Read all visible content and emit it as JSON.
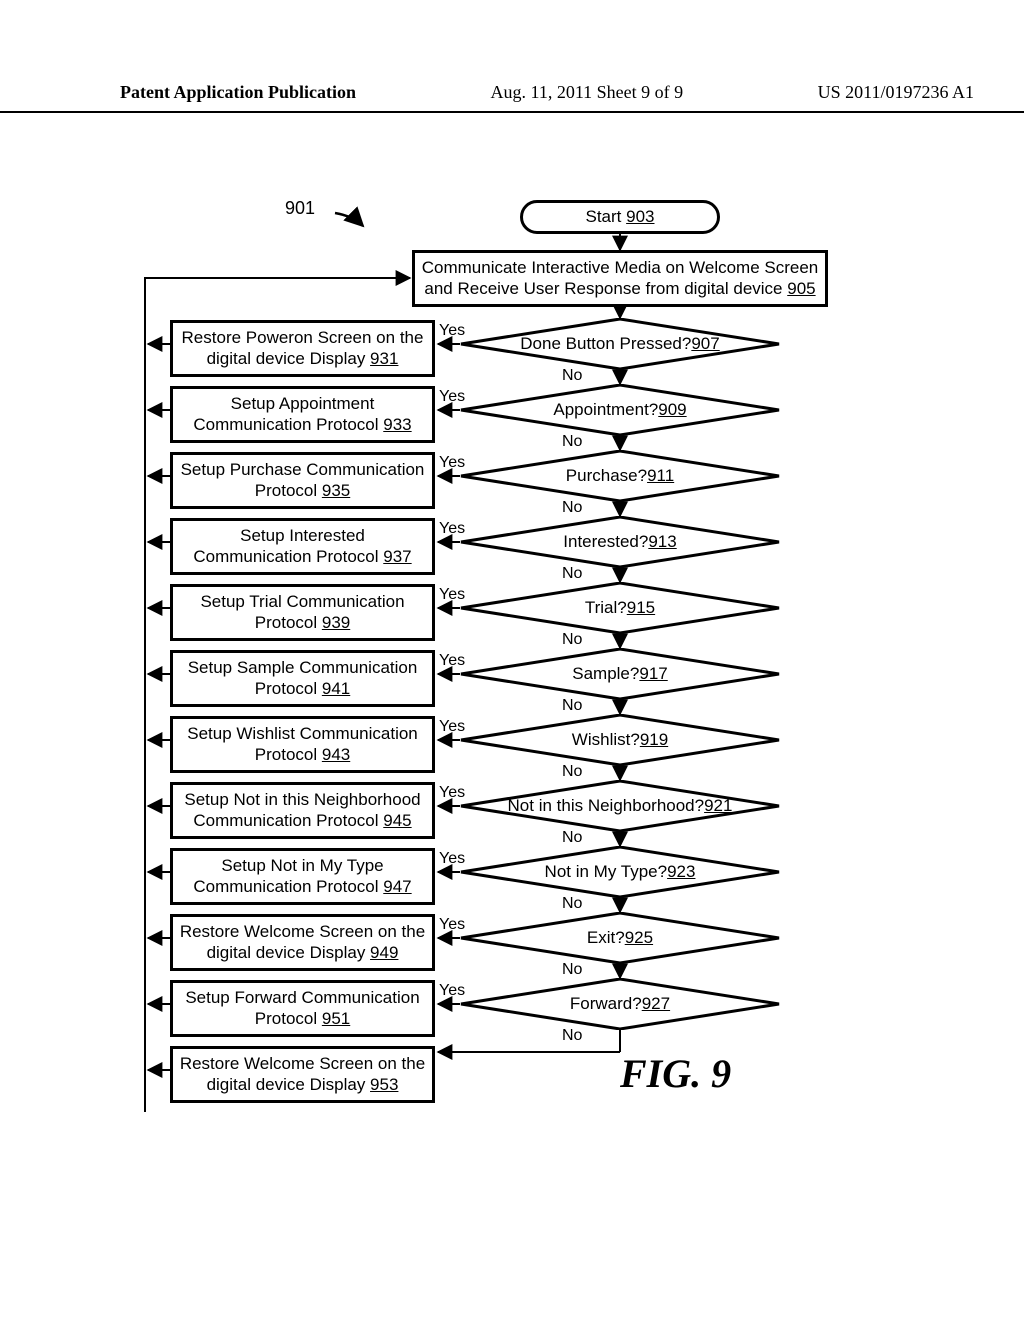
{
  "header": {
    "left": "Patent Application Publication",
    "center": "Aug. 11, 2011  Sheet 9 of 9",
    "right": "US 2011/0197236 A1"
  },
  "ref901": "901",
  "start": {
    "label": "Start ",
    "ref": "903"
  },
  "comm": {
    "label": "Communicate Interactive Media on Welcome Screen and Receive User Response from digital device ",
    "ref": "905"
  },
  "yes": "Yes",
  "no": "No",
  "decisions": [
    {
      "label": "Done Button Pressed? ",
      "ref": "907"
    },
    {
      "label": "Appointment? ",
      "ref": "909"
    },
    {
      "label": "Purchase? ",
      "ref": "911"
    },
    {
      "label": "Interested? ",
      "ref": "913"
    },
    {
      "label": "Trial? ",
      "ref": "915"
    },
    {
      "label": "Sample? ",
      "ref": "917"
    },
    {
      "label": "Wishlist? ",
      "ref": "919"
    },
    {
      "label": "Not in this Neighborhood? ",
      "ref": "921"
    },
    {
      "label": "Not in My Type? ",
      "ref": "923"
    },
    {
      "label": "Exit? ",
      "ref": "925"
    },
    {
      "label": "Forward? ",
      "ref": "927"
    }
  ],
  "actions": [
    {
      "label": "Restore Poweron Screen on the digital device Display ",
      "ref": "931"
    },
    {
      "label": "Setup Appointment Communication Protocol ",
      "ref": "933"
    },
    {
      "label": "Setup Purchase Communication Protocol ",
      "ref": "935"
    },
    {
      "label": "Setup Interested Communication Protocol ",
      "ref": "937"
    },
    {
      "label": "Setup Trial Communication Protocol ",
      "ref": "939"
    },
    {
      "label": "Setup Sample Communication Protocol ",
      "ref": "941"
    },
    {
      "label": "Setup Wishlist Communication Protocol ",
      "ref": "943"
    },
    {
      "label": "Setup Not in this Neighborhood Communication Protocol ",
      "ref": "945"
    },
    {
      "label": "Setup Not in My Type Communication Protocol ",
      "ref": "947"
    },
    {
      "label": "Restore Welcome Screen on the digital device Display ",
      "ref": "949"
    },
    {
      "label": "Setup Forward Communication Protocol ",
      "ref": "951"
    },
    {
      "label": "Restore Welcome Screen on the digital device Display ",
      "ref": "953"
    }
  ],
  "fig": "FIG. 9"
}
